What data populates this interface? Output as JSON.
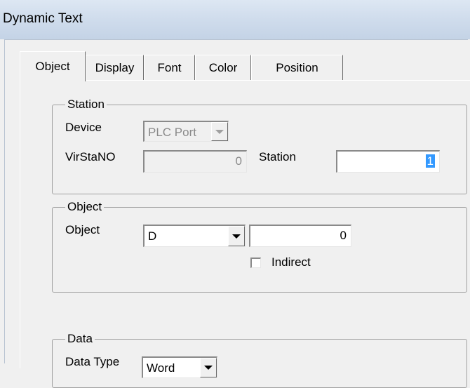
{
  "window": {
    "title": "Dynamic Text"
  },
  "tabs": [
    {
      "label": "Object"
    },
    {
      "label": "Display"
    },
    {
      "label": "Font"
    },
    {
      "label": "Color"
    },
    {
      "label": "Position"
    }
  ],
  "active_tab": "Object",
  "station_group": {
    "title": "Station",
    "device_label": "Device",
    "device_value": "PLC Port",
    "virstano_label": "VirStaNO",
    "virstano_value": "0",
    "station_label": "Station",
    "station_value": "1"
  },
  "object_group": {
    "title": "Object",
    "object_label": "Object",
    "object_type": "D",
    "object_address": "0",
    "indirect_label": "Indirect",
    "indirect_checked": false
  },
  "data_group": {
    "title": "Data",
    "data_type_label": "Data Type",
    "data_type_value": "Word"
  }
}
